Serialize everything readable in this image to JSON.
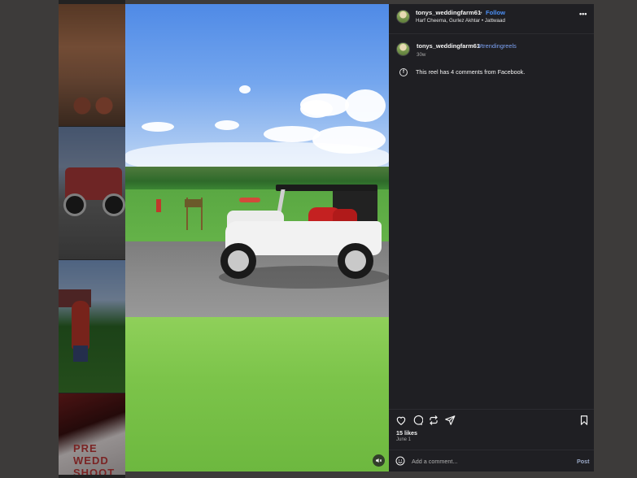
{
  "header": {
    "username": "tonys_weddingfarm61",
    "separator": "•",
    "follow_label": "Follow",
    "location": "Harf Cheema, Gurlez Akhtar • Jattwaad",
    "more_icon": "more-horizontal-icon"
  },
  "caption": {
    "username": "tonys_weddingfarm61",
    "hashtag": "#trendingreels",
    "time_ago": "30w"
  },
  "facebook_notice": {
    "icon": "facebook-icon",
    "text": "This reel has 4 comments from Facebook."
  },
  "actions": {
    "icons": [
      "heart-icon",
      "comment-icon",
      "repost-icon",
      "share-icon",
      "bookmark-icon"
    ],
    "likes": "15 likes",
    "date": "June 1"
  },
  "comment_bar": {
    "emoji_icon": "emoji-icon",
    "placeholder": "Add a comment...",
    "post_label": "Post"
  },
  "media": {
    "mute_icon": "mute-icon"
  },
  "background_tiles": {
    "tile4_text": "PRE WEDD SHOOT"
  },
  "colors": {
    "panel_bg": "#1f1f23",
    "link_blue": "#4b8ff5",
    "hashtag_blue": "#7da3f5"
  }
}
